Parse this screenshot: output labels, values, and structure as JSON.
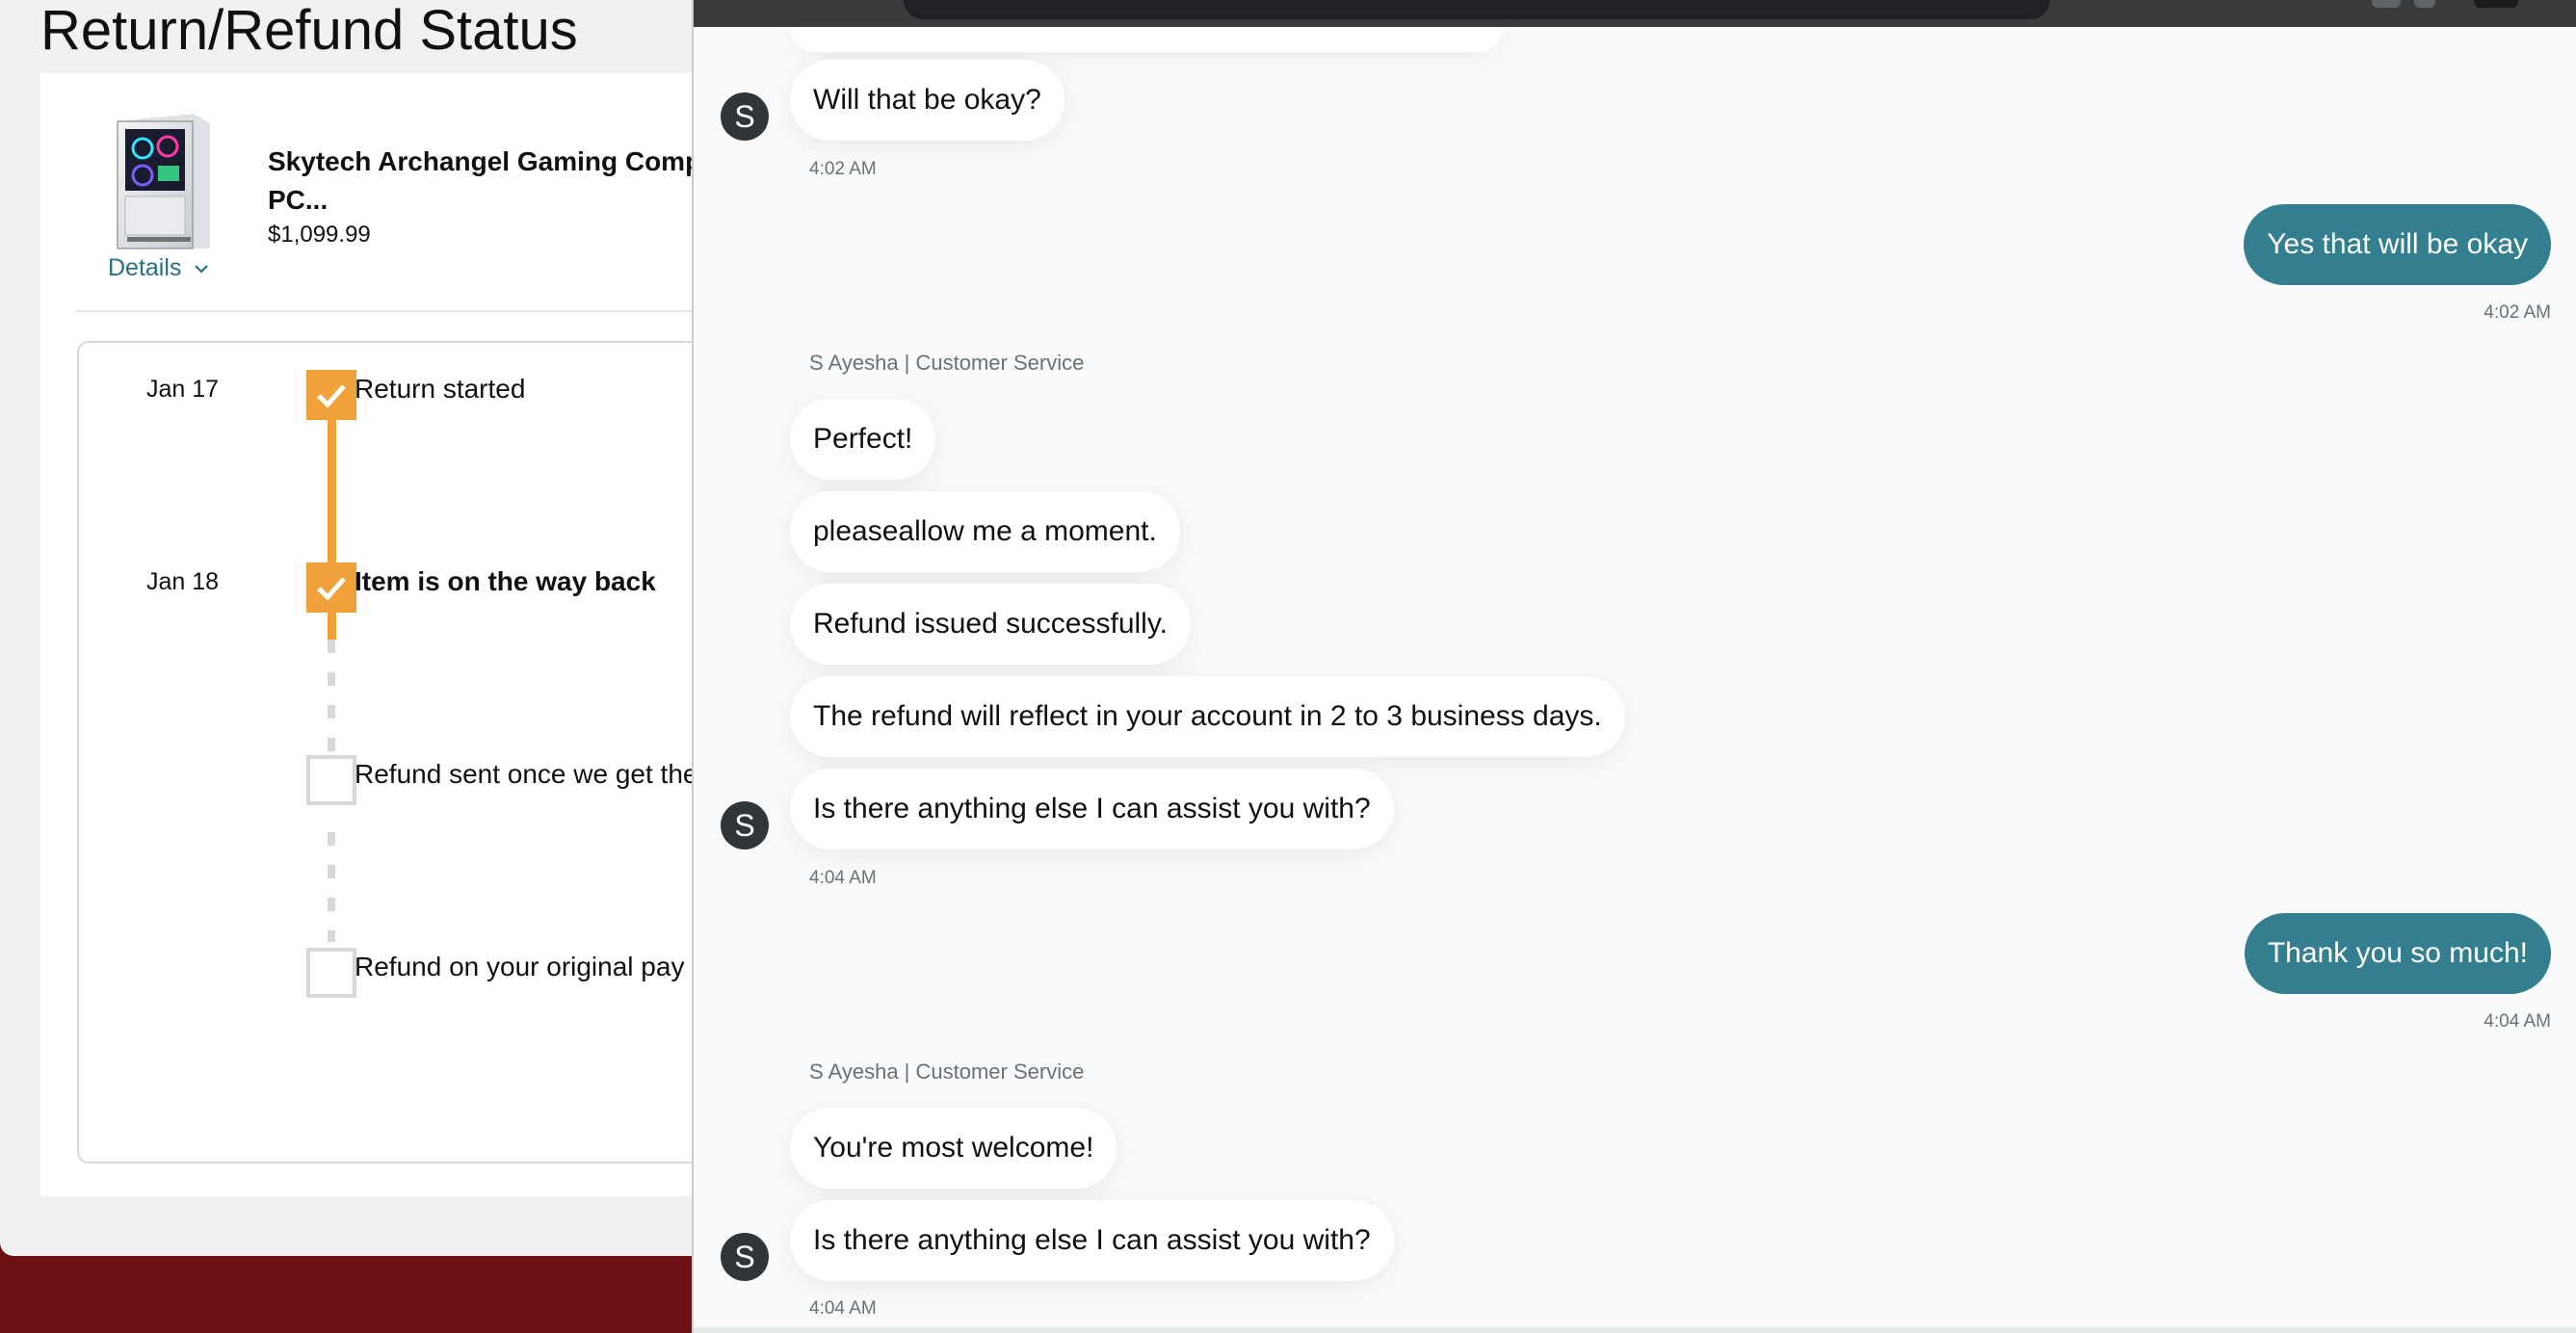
{
  "return_page": {
    "title": "Return/Refund Status",
    "product": {
      "name": "Skytech Archangel Gaming Comp PC...",
      "price": "$1,099.99",
      "details_label": "Details"
    },
    "timeline": [
      {
        "date": "Jan 17",
        "label": "Return started",
        "done": true
      },
      {
        "date": "Jan 18",
        "label": "Item is on the way back",
        "done": true
      },
      {
        "date": "",
        "label": "Refund sent once we get the",
        "done": false
      },
      {
        "date": "",
        "label": "Refund on your original pay",
        "done": false
      }
    ]
  },
  "chat": {
    "avatar_letter": "S",
    "sender_name": "S Ayesha | Customer Service",
    "messages": [
      {
        "from": "agent",
        "text": "Will that be okay?"
      },
      {
        "from": "agent",
        "text": "4:02 AM"
      },
      {
        "from": "user",
        "text": "Yes that will be okay"
      },
      {
        "from": "user",
        "text": "4:02 AM"
      },
      {
        "from": "agent",
        "text": "Perfect!"
      },
      {
        "from": "agent",
        "text": "pleaseallow me a moment."
      },
      {
        "from": "agent",
        "text": "Refund issued successfully."
      },
      {
        "from": "agent",
        "text": "The refund will reflect in your account in 2 to 3 business days."
      },
      {
        "from": "agent",
        "text": "Is there anything else I can assist you with?"
      },
      {
        "from": "agent",
        "text": "4:04 AM"
      },
      {
        "from": "user",
        "text": "Thank you so much!"
      },
      {
        "from": "user",
        "text": "4:04 AM"
      },
      {
        "from": "agent",
        "text": "You're most welcome!"
      },
      {
        "from": "agent",
        "text": "Is there anything else I can assist you with?"
      },
      {
        "from": "agent",
        "text": "4:04 AM"
      }
    ]
  },
  "colors": {
    "accent_orange": "#f0a139",
    "user_bubble": "#337f8f",
    "link_teal": "#2a6f82",
    "desktop_background": "#6e1114"
  },
  "icons": [
    "check-icon",
    "chevron-down-icon",
    "gaming-pc-image"
  ]
}
